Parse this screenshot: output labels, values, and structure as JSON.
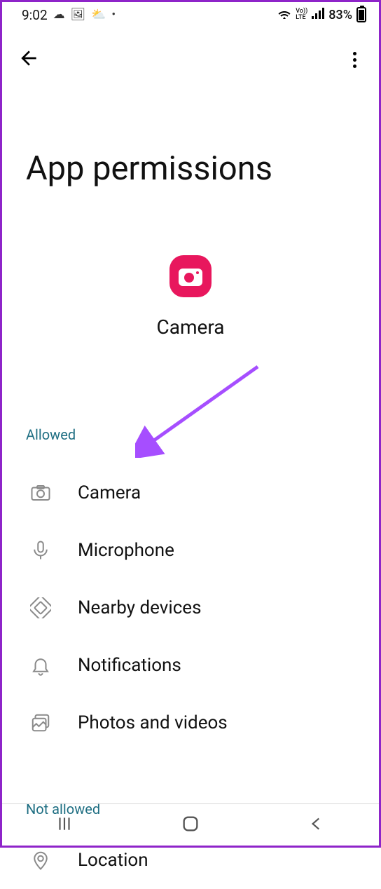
{
  "status": {
    "time": "9:02",
    "battery_pct": "83%"
  },
  "page": {
    "title": "App permissions",
    "app_name": "Camera"
  },
  "sections": {
    "allowed_label": "Allowed",
    "not_allowed_label": "Not allowed"
  },
  "permissions_allowed": {
    "camera": "Camera",
    "microphone": "Microphone",
    "nearby": "Nearby devices",
    "notifications": "Notifications",
    "photos": "Photos and videos"
  },
  "permissions_not_allowed": {
    "location": "Location"
  }
}
